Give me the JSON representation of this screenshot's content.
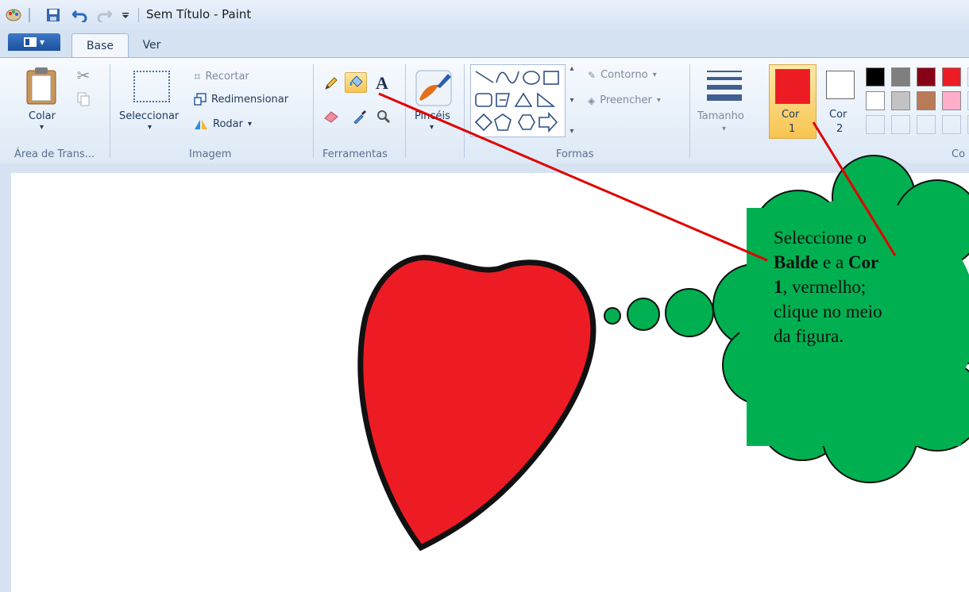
{
  "window": {
    "title": "Sem Título - Paint"
  },
  "tabs": {
    "base": "Base",
    "ver": "Ver"
  },
  "clipboard": {
    "paste_label": "Colar",
    "group_label": "Área de Trans..."
  },
  "image": {
    "select_label": "Seleccionar",
    "crop_label": "Recortar",
    "resize_label": "Redimensionar",
    "rotate_label": "Rodar",
    "group_label": "Imagem"
  },
  "tools": {
    "group_label": "Ferramentas",
    "selected": "fill-bucket"
  },
  "brushes": {
    "label": "Pincéis"
  },
  "shapes": {
    "outline_label": "Contorno",
    "fill_label": "Preencher",
    "group_label": "Formas"
  },
  "size": {
    "label": "Tamanho"
  },
  "colors": {
    "color1_label": "Cor",
    "color1_num": "1",
    "color2_label": "Cor",
    "color2_num": "2",
    "group_label": "Co",
    "color1_value": "#ed1c24",
    "color2_value": "#ffffff",
    "palette_row1": [
      "#000000",
      "#7f7f7f",
      "#880015",
      "#ed1c24"
    ],
    "palette_row2": [
      "#ffffff",
      "#c3c3c3",
      "#b97a57",
      "#ffaec9"
    ]
  },
  "callout": {
    "line1": "Seleccione o",
    "bold_balde": "Balde",
    "mid": " e a ",
    "bold_cor": "Cor",
    "bold_1": "1",
    "rest1": ", vermelho;",
    "rest2": "clique no meio",
    "rest3": "da figura."
  },
  "accent": {
    "heart_fill": "#ed1c24",
    "cloud_fill": "#00b050",
    "arrow_color": "#e00000"
  }
}
